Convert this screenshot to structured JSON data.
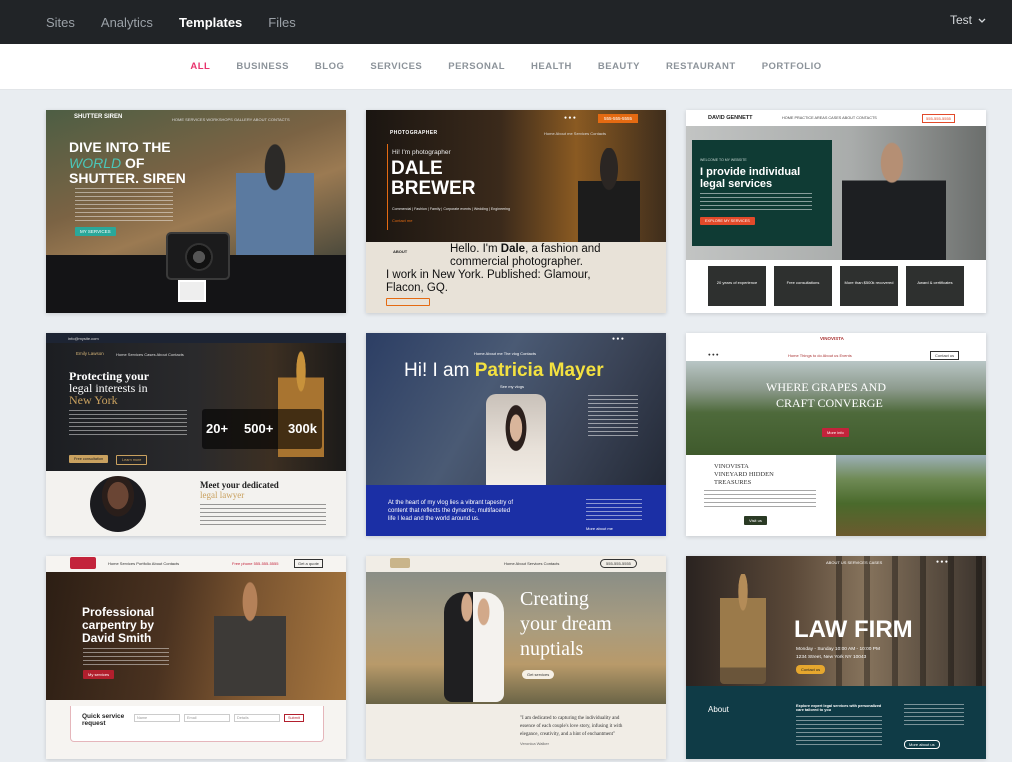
{
  "nav": {
    "items": [
      "Sites",
      "Analytics",
      "Templates",
      "Files"
    ],
    "active": "Templates"
  },
  "account": {
    "name": "Test"
  },
  "categories": {
    "items": [
      "ALL",
      "BUSINESS",
      "BLOG",
      "SERVICES",
      "PERSONAL",
      "HEALTH",
      "BEAUTY",
      "RESTAURANT",
      "PORTFOLIO"
    ],
    "active": "ALL"
  },
  "colors": {
    "accent": "#e8336d",
    "topbar": "#212427"
  },
  "templates": {
    "shutter": {
      "logo": "SHUTTER SIREN",
      "line1": "DIVE INTO THE",
      "line2a": "WORLD",
      "line2b": " OF",
      "line3": "SHUTTER. SIREN",
      "btn": "MY SERVICES",
      "menu": "HOME   SERVICES   WORKSHOPS   GALLERY   ABOUT   CONTACTS"
    },
    "dale": {
      "brand": "PHOTOGRAPHER",
      "hi": "Hi! I'm photographer",
      "name1": "DALE",
      "name2": "BREWER",
      "tags": "Commercial | Fashion | Family | Corporate events | Wedding | Engineering",
      "contact": "Contact me",
      "about": "ABOUT",
      "intro_a": "Hello. I'm ",
      "intro_b": "Dale",
      "intro_c": ", a fashion and",
      "intro2": "commercial photographer.",
      "intro3": "I work in New York. Published: Glamour,",
      "intro4": "Flacon, GQ.",
      "phone": "555-555-5555",
      "menu": "Home   About me   Services   Contacts"
    },
    "legal": {
      "brand": "DAVID GENNETT",
      "headline1": "I provide individual",
      "headline2": "legal services",
      "welcome": "WELCOME TO MY WEBSITE",
      "btn": "EXPLORE MY SERVICES",
      "phone": "555-555-5555",
      "menu": "HOME   PRACTICE AREAS   CASES   ABOUT   CONTACTS",
      "stats": [
        "20 years of experience",
        "Free consultations",
        "More than $500k recovered",
        "Award & certificates"
      ]
    },
    "emily": {
      "brand": "Emily Lawson",
      "h1": "Protecting your",
      "h2": "legal interests in",
      "h3": "New York",
      "stats": [
        "20+",
        "500+",
        "300k"
      ],
      "stat_labels": [
        "Years of experience",
        "Clients served",
        "$ recovered"
      ],
      "meet1": "Meet your dedicated",
      "meet2": "legal lawyer",
      "btn1": "Free consultation",
      "btn2": "Learn more",
      "email": "info@mysite.com",
      "menu": "Home   Services   Cases   About   Contacts"
    },
    "patricia": {
      "hi": "Hi! I am ",
      "name": "Patricia Mayer",
      "tag": "See my vlogs",
      "bottom1": "At the heart of my vlog lies a vibrant tapestry of",
      "bottom2": "content that reflects the dynamic, multifaceted",
      "bottom3": "life I lead and the world around us.",
      "more": "More about me",
      "menu": "Home   About me   The vlog   Contacts"
    },
    "vino": {
      "brand": "VINOVISTA",
      "h1": "WHERE GRAPES AND",
      "h2": "CRAFT CONVERGE",
      "btn": "More info",
      "sub1": "VINOVISTA",
      "sub2": "VINEYARD HIDDEN",
      "sub3": "TREASURES",
      "btn2": "Visit us",
      "contact": "Contact us",
      "menu": "Home   Things to do   About us   Events"
    },
    "carpentry": {
      "h1": "Professional",
      "h2": "carpentry by",
      "h3": "David Smith",
      "btn": "My services",
      "quick1": "Quick service",
      "quick2": "request",
      "fields": [
        "Name",
        "Email",
        "Details"
      ],
      "submit": "Submit",
      "phone": "Free phone 555-555-5555",
      "quote": "Get a quote",
      "menu": "Home   Services   Portfolio   About   Contacts"
    },
    "wedding": {
      "h1": "Creating",
      "h2": "your dream",
      "h3": "nuptials",
      "btn": "Get services",
      "quote1": "\"I am dedicated to capturing the individuality and",
      "quote2": "essence of each couple's love story, infusing it with",
      "quote3": "elegance, creativity, and a hint of enchantment\"",
      "sign": "Veronica Walker",
      "phone": "555-555-5555",
      "menu": "Home   About   Services   Contacts"
    },
    "lawfirm": {
      "title": "LAW FIRM",
      "hours": "Monday - Sunday 10:00 AM - 10:00 PM",
      "address": "1234 Street, New York NY 10043",
      "btn": "Contact us",
      "about": "About",
      "explore": "Explore expert legal services with personalized care tailored to you",
      "btn2": "More about us",
      "menu": "ABOUT US   SERVICES   CASES"
    }
  }
}
